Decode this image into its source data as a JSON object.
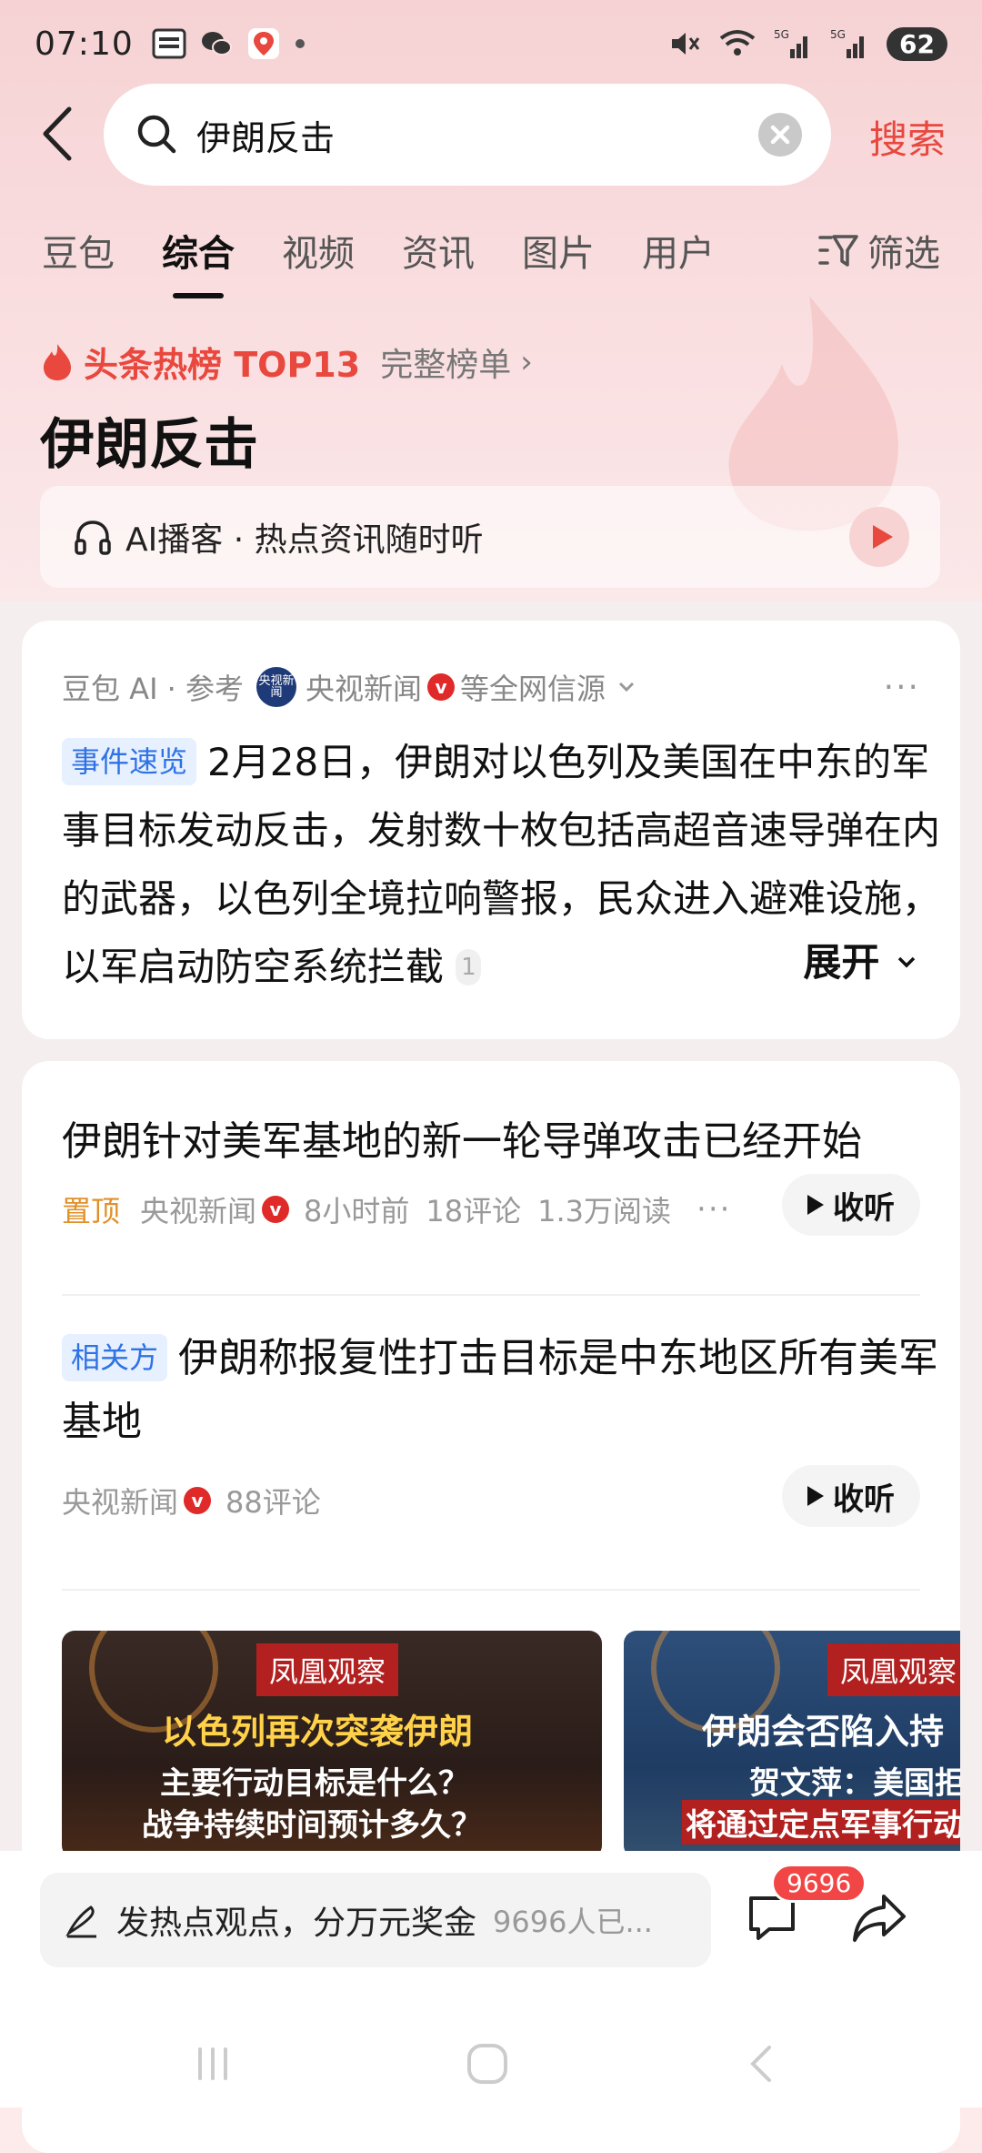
{
  "status_bar": {
    "time": "07:10",
    "app_icons": [
      "toutiao-icon",
      "wechat-icon",
      "maps-icon"
    ],
    "battery": "62"
  },
  "search": {
    "query": "伊朗反击",
    "button": "搜索"
  },
  "tabs": [
    {
      "label": "豆包"
    },
    {
      "label": "综合"
    },
    {
      "label": "视频"
    },
    {
      "label": "资讯"
    },
    {
      "label": "图片"
    },
    {
      "label": "用户"
    }
  ],
  "filter_label": "筛选",
  "hot_board": {
    "title": "头条热榜 TOP13",
    "full_list": "完整榜单",
    "topic": "伊朗反击"
  },
  "ai_podcast": {
    "label": "AI播客 · 热点资讯随时听"
  },
  "ai_summary": {
    "source_prefix": "豆包 AI · 参考",
    "source_name": "央视新闻",
    "source_suffix": "等全网信源",
    "cctv_logo_text": "央视新闻",
    "tag": "事件速览",
    "text": "2月28日，伊朗对以色列及美国在中东的军事目标发动反击，发射数十枚包括高超音速导弹在内的武器，以色列全境拉响警报，民众进入避难设施，以军启动防空系统拦截",
    "ref": "1",
    "expand": "展开"
  },
  "news": [
    {
      "title": "伊朗针对美军基地的新一轮导弹攻击已经开始",
      "pin": "置顶",
      "source": "央视新闻",
      "time": "8小时前",
      "comments": "18评论",
      "reads": "1.3万阅读",
      "listen": "收听"
    },
    {
      "tag": "相关方",
      "title": "伊朗称报复性打击目标是中东地区所有美军基地",
      "source": "央视新闻",
      "comments": "88评论",
      "listen": "收听"
    }
  ],
  "thumbnails": [
    {
      "badge": "凤凰观察",
      "line1": "以色列再次突袭伊朗",
      "line2": "主要行动目标是什么？",
      "line3": "战争持续时间预计多久？"
    },
    {
      "badge": "凤凰观察",
      "line1": "伊朗会否陷入持",
      "line2": "贺文萍：美国拒",
      "line3": "将通过定点军事行动"
    }
  ],
  "comment_bar": {
    "placeholder": "发热点观点，分万元奖金",
    "participants": "9696人已...",
    "badge": "9696"
  },
  "colors": {
    "accent_red": "#e8483e",
    "tag_blue": "#2f72e4",
    "pin_orange": "#e0902a"
  }
}
